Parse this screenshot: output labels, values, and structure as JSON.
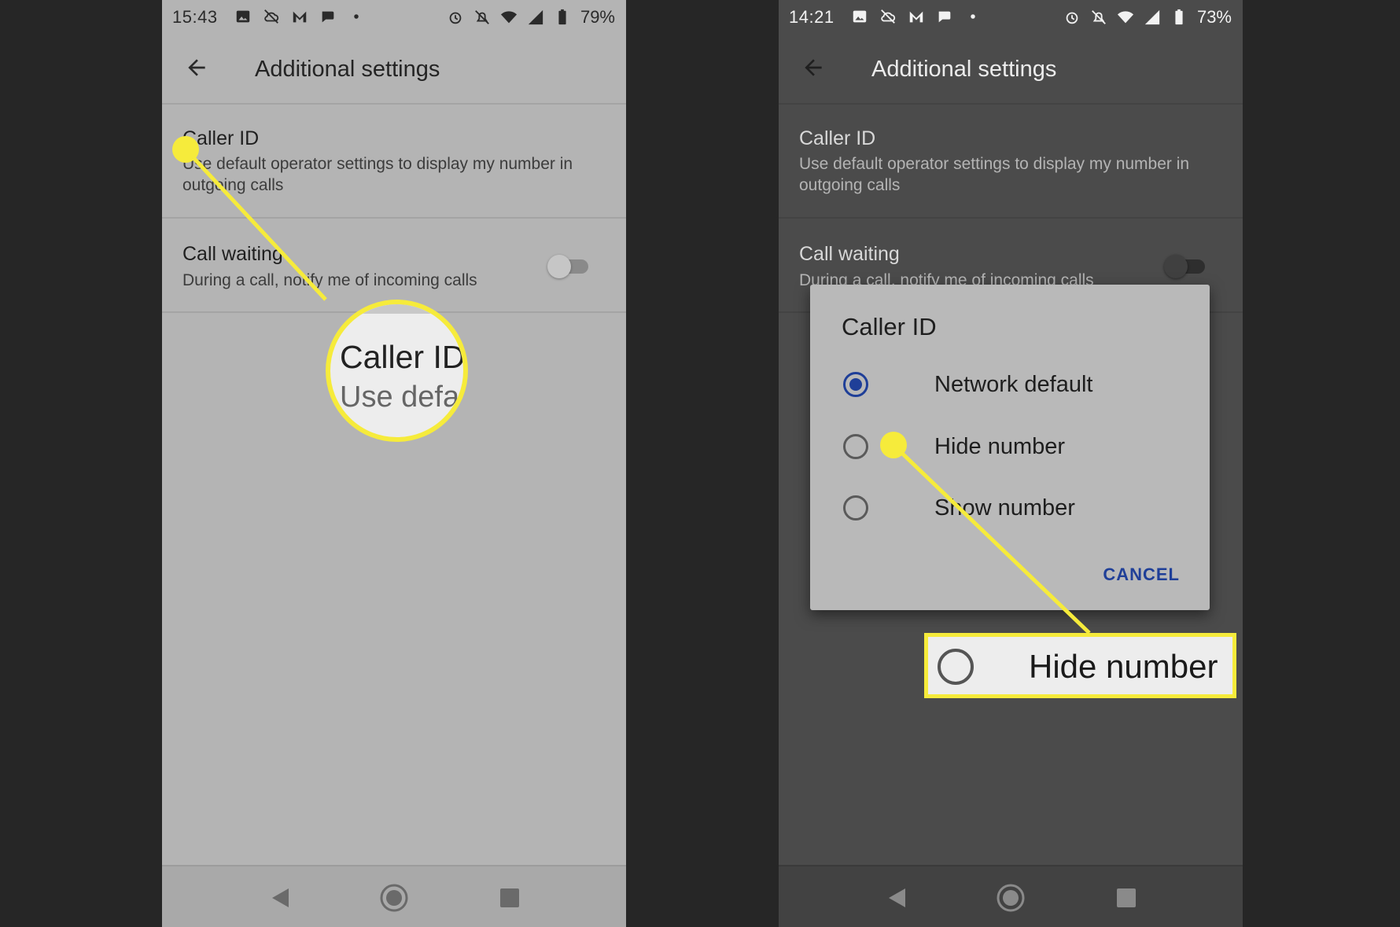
{
  "left_screen": {
    "status": {
      "time": "15:43",
      "battery": "79%"
    },
    "appbar": {
      "title": "Additional settings"
    },
    "prefs": [
      {
        "title": "Caller ID",
        "summary": "Use default operator settings to display my number in outgoing calls"
      },
      {
        "title": "Call waiting",
        "summary": "During a call, notify me of incoming calls",
        "toggle_on": false
      }
    ],
    "magnifier": {
      "title": "Caller ID",
      "subtitle": "Use defa"
    }
  },
  "right_screen": {
    "status": {
      "time": "14:21",
      "battery": "73%"
    },
    "appbar": {
      "title": "Additional settings"
    },
    "prefs": [
      {
        "title": "Caller ID",
        "summary": "Use default operator settings to display my number in outgoing calls"
      },
      {
        "title": "Call waiting",
        "summary": "During a call, notify me of incoming calls",
        "toggle_on": false
      }
    ],
    "dialog": {
      "title": "Caller ID",
      "options": [
        {
          "label": "Network default",
          "selected": true
        },
        {
          "label": "Hide number",
          "selected": false
        },
        {
          "label": "Show number",
          "selected": false
        }
      ],
      "cancel_label": "CANCEL"
    },
    "zoom": {
      "label": "Hide number"
    }
  },
  "colors": {
    "highlight": "#f6eb3b",
    "accent": "#1f3f98"
  }
}
